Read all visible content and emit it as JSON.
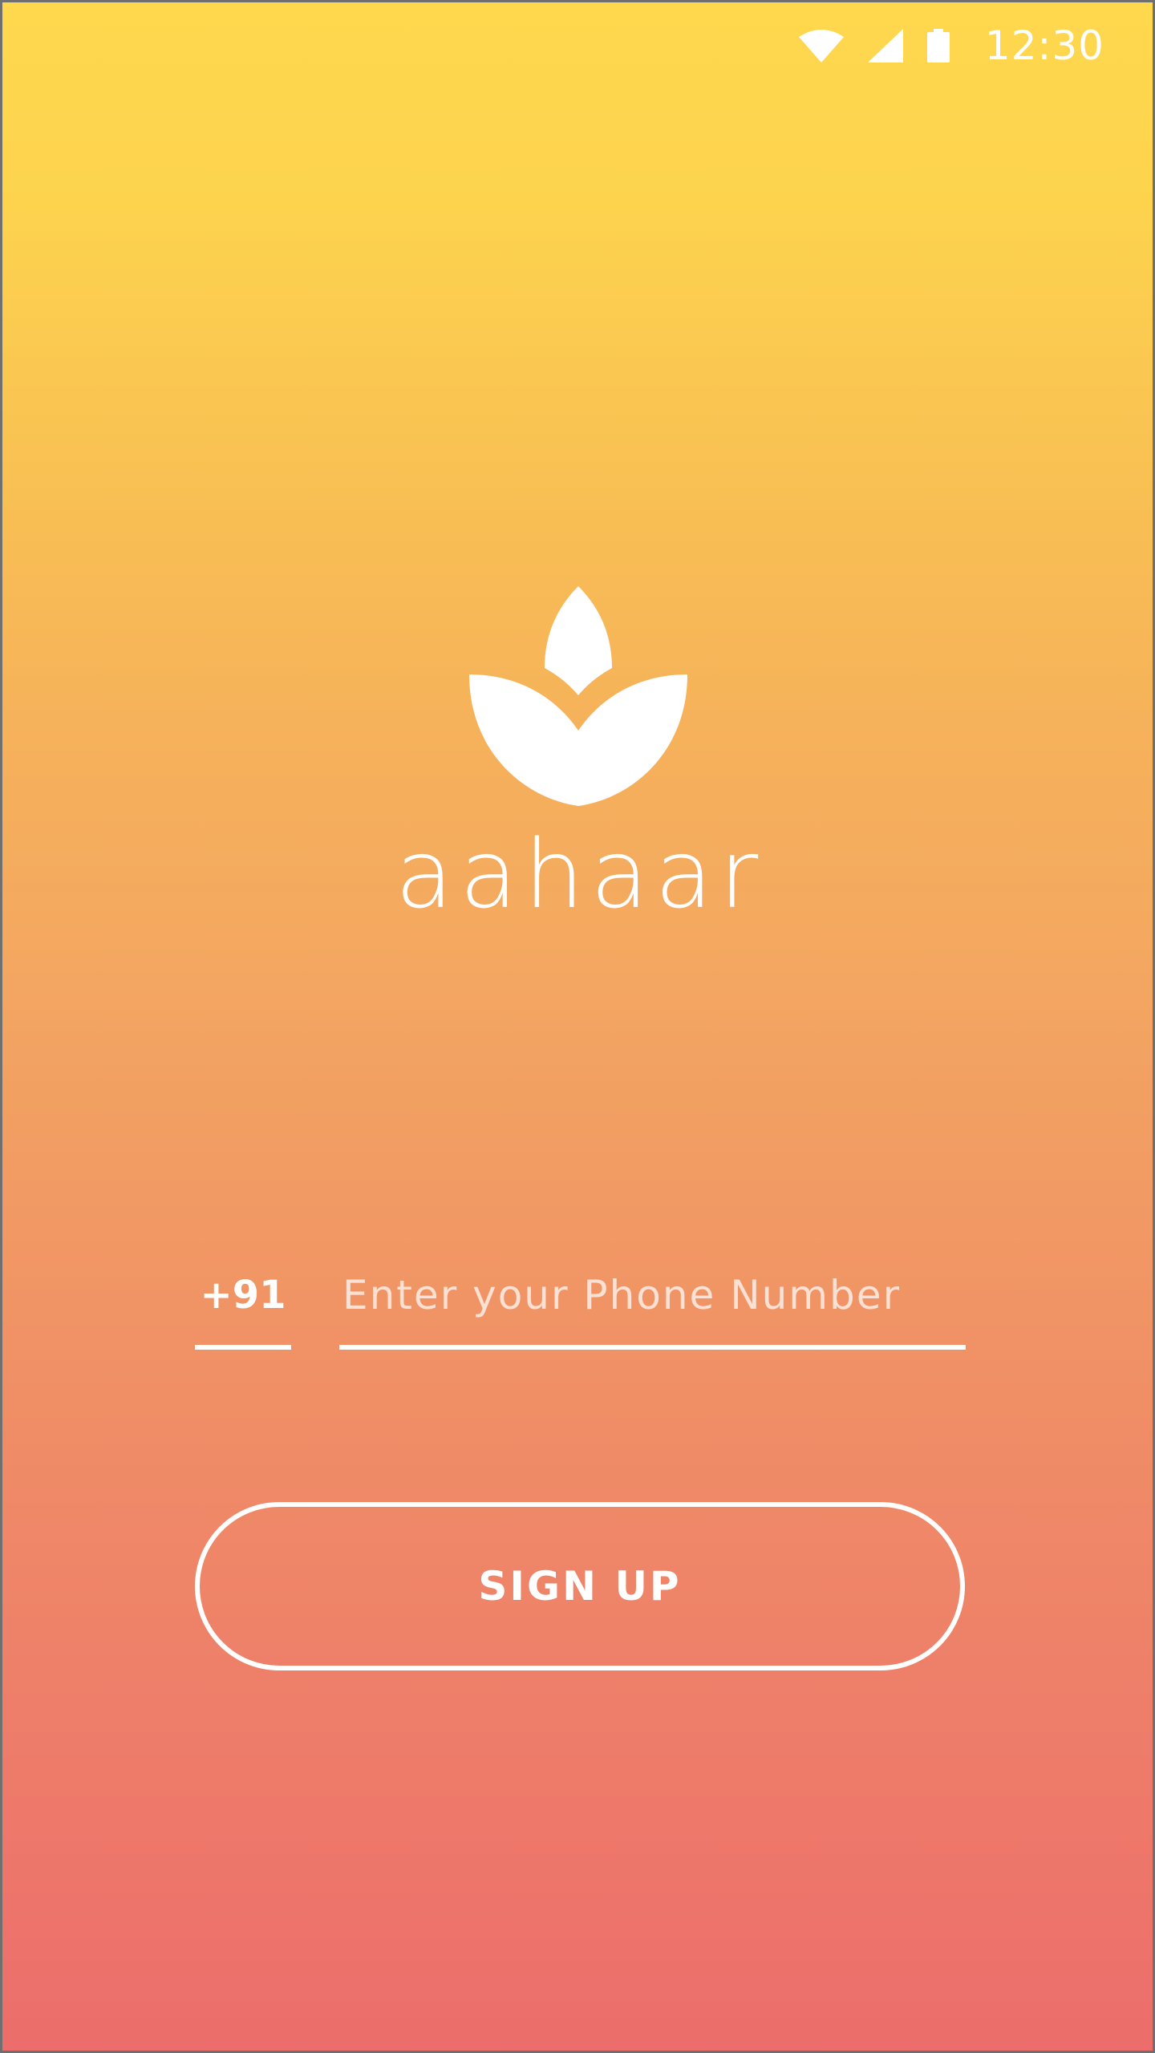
{
  "status_bar": {
    "time": "12:30",
    "icons": [
      "wifi-icon",
      "cellular-signal-icon",
      "battery-icon"
    ]
  },
  "brand": {
    "logo_icon": "lotus-leaf-icon",
    "name": "aahaar"
  },
  "phone_form": {
    "country_code": "+91",
    "phone_value": "",
    "phone_placeholder": "Enter your Phone Number"
  },
  "signup_button": {
    "label": "SIGN UP"
  },
  "colors": {
    "gradient_top": "#ffd84e",
    "gradient_bottom": "#ec6d6b",
    "foreground": "#ffffff"
  }
}
